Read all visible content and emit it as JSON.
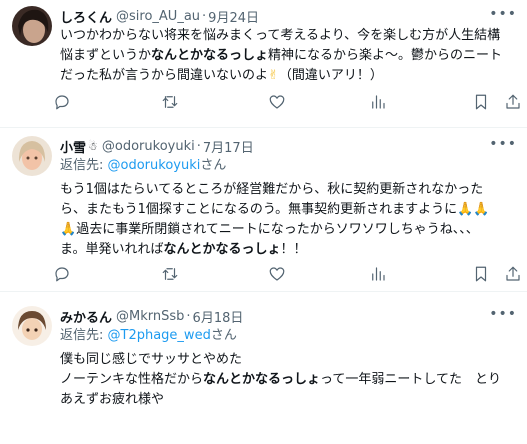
{
  "tweets": [
    {
      "display_name": "しろくん",
      "handle": "@siro_AU_au",
      "date": "9月24日",
      "lines": [
        [
          "いつかわからない将来を悩みまくって考えるより、今を楽しむ方が人生結構"
        ],
        [
          "悩まずというか",
          "なんとかなるっしょ",
          "精神になるから楽よ～。鬱からのニート"
        ],
        [
          "だった私が言うから間違いないのよ",
          "✌",
          "（間違いアリ！）"
        ]
      ],
      "avatar_colors": [
        "#3a2a25",
        "#c9a48d"
      ]
    },
    {
      "display_name": "小雪",
      "handle": "@odorukoyuki",
      "date": "7月17日",
      "reply_prefix": "返信先: ",
      "reply_to": "@odorukoyuki",
      "reply_suffix": "さん",
      "lines": [
        [
          "もう1個はたらいてるところが経営難だから、秋に契約更新されなかった"
        ],
        [
          "ら、またもう1個探すことになるのう。無事契約更新されますように",
          "🙏🙏"
        ],
        [
          "🙏",
          "過去に事業所閉鎖されてニートになったからソワソワしちゃうね、、、"
        ],
        [
          "ま。単発いれれば",
          "なんとかなるっしょ",
          "！！"
        ]
      ],
      "avatar_colors": [
        "#e8d9c4",
        "#f2c3a7"
      ]
    },
    {
      "display_name": "みかるん",
      "handle": "@MkrnSsb",
      "date": "6月18日",
      "reply_prefix": "返信先: ",
      "reply_to": "@T2phage_wed",
      "reply_suffix": "さん",
      "lines": [
        [
          "僕も同じ感じでサッサとやめた"
        ],
        [
          "ノーテンキな性格だから",
          "なんとかなるっしょ",
          "って一年弱ニートしてた　とり"
        ],
        [
          "あえずお疲れ様や"
        ]
      ],
      "avatar_colors": [
        "#6b4a32",
        "#f3d2b5"
      ]
    }
  ],
  "icons": {
    "more": "more-icon",
    "reply": "reply-icon",
    "retweet": "retweet-icon",
    "like": "like-icon",
    "views": "views-icon",
    "bookmark": "bookmark-icon",
    "share": "share-icon"
  },
  "colors": {
    "text": "#0f1419",
    "secondary": "#536471",
    "link": "#1d9bf0",
    "divider": "#eff3f4"
  }
}
